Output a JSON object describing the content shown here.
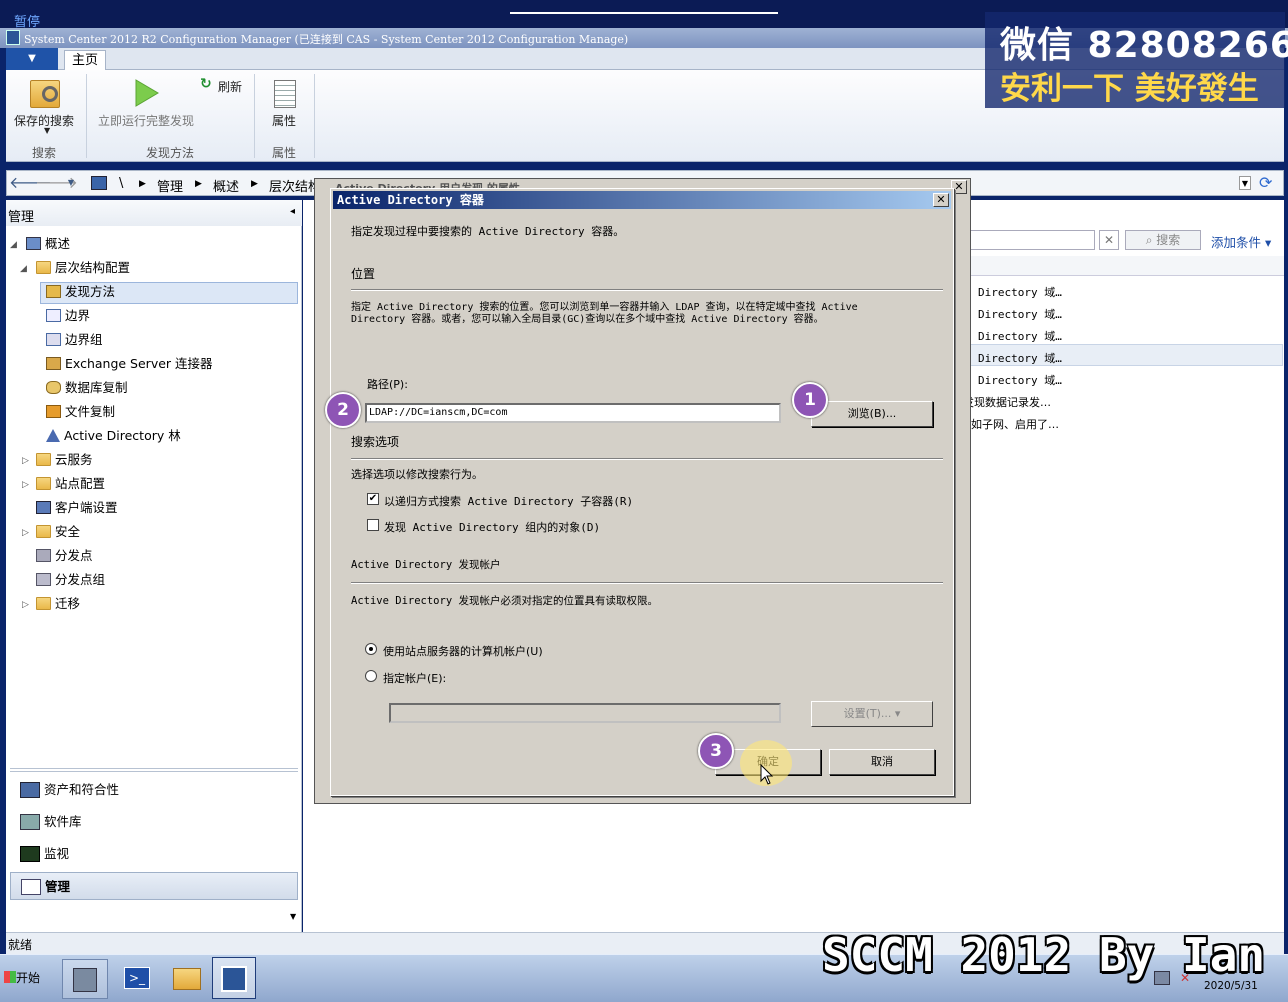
{
  "screen": {
    "paused_label": "暂停"
  },
  "window": {
    "title": "System Center 2012 R2 Configuration Manager (已连接到 CAS - System Center 2012 Configuration Manage)"
  },
  "ribbon": {
    "home_tab": "主页",
    "saved_search": "保存的搜索",
    "run_discovery": "立即运行完整发现",
    "refresh": "刷新",
    "properties": "属性",
    "group_search": "搜索",
    "group_discovery": "发现方法",
    "group_properties": "属性"
  },
  "breadcrumb": {
    "root": "\\",
    "items": [
      "管理",
      "概述",
      "层次结构"
    ]
  },
  "left_pane": {
    "header": "管理",
    "tree": [
      "概述",
      "层次结构配置",
      "发现方法",
      "边界",
      "边界组",
      "Exchange Server 连接器",
      "数据库复制",
      "文件复制",
      "Active Directory 林",
      "云服务",
      "站点配置",
      "客户端设置",
      "安全",
      "分发点",
      "分发点组",
      "迁移"
    ],
    "workspaces": [
      "资产和符合性",
      "软件库",
      "监视",
      "管理"
    ]
  },
  "right_pane": {
    "search_button": "搜索",
    "add_criteria": "添加条件",
    "rows": [
      "Directory 域…",
      "Directory 域…",
      "Directory 域…",
      "Directory 域…",
      "Directory 域…",
      "发现数据记录发…",
      "如子网、启用了…"
    ]
  },
  "status_bar": {
    "text": "就绪"
  },
  "taskbar": {
    "start": "开始",
    "date": "2020/5/31"
  },
  "back_dialog": {
    "title": "Active Directory 用户发现 的属性"
  },
  "dialog": {
    "title": "Active Directory 容器",
    "intro": "指定发现过程中要搜索的 Active Directory 容器。",
    "location_header": "位置",
    "location_desc_1": "指定 Active Directory 搜索的位置。您可以浏览到单一容器并输入 LDAP 查询，以在特定域中查找 Active",
    "location_desc_2": "Directory 容器。或者，您可以输入全局目录(GC)查询以在多个域中查找 Active Directory 容器。",
    "path_label": "路径(P):",
    "path_value": "LDAP://DC=ianscm,DC=com",
    "browse_button": "浏览(B)...",
    "search_options_header": "搜索选项",
    "search_options_desc": "选择选项以修改搜索行为。",
    "recursive_label": "以递归方式搜索 Active Directory 子容器(R)",
    "group_objects_label": "发现 Active Directory 组内的对象(D)",
    "account_header": "Active Directory 发现帐户",
    "account_desc": "Active Directory 发现帐户必须对指定的位置具有读取权限。",
    "radio_computer_account": "使用站点服务器的计算机帐户(U)",
    "radio_specify_account": "指定帐户(E):",
    "set_button": "设置(T)...",
    "ok_button": "确定",
    "cancel_button": "取消"
  },
  "steps": [
    "1",
    "2",
    "3"
  ],
  "watermark": {
    "line1": "微信 82808266",
    "line2": "安利一下 美好發生",
    "signature": "SCCM 2012 By Ian"
  }
}
